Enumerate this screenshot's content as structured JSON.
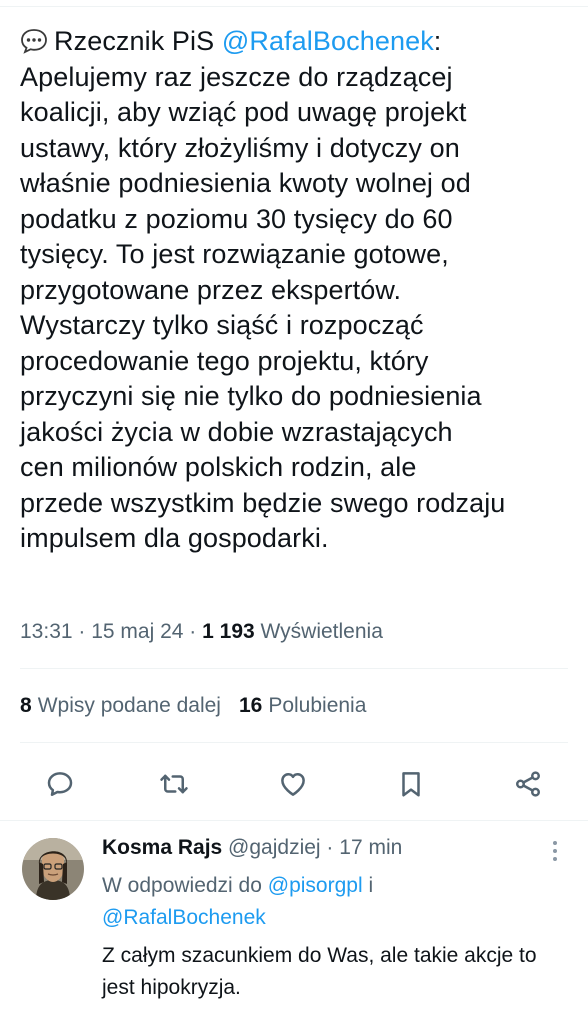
{
  "tweet": {
    "emoji_icon": "speech-bubble-icon",
    "prefix": "Rzecznik PiS ",
    "mention": "@RafalBochenek",
    "after_mention": ":",
    "lines": [
      "Apelujemy raz jeszcze do rządzącej",
      "koalicji, aby wziąć pod uwagę projekt",
      "ustawy, który złożyliśmy i dotyczy on",
      "właśnie podniesienia kwoty wolnej od",
      "podatku z poziomu 30 tysięcy do 60",
      "tysięcy. To jest rozwiązanie gotowe,",
      "przygotowane przez ekspertów.",
      "Wystarczy tylko siąść i rozpocząć",
      "procedowanie tego projektu, który",
      "przyczyni się nie tylko do podniesienia",
      "jakości życia w dobie wzrastających",
      "cen milionów polskich rodzin, ale",
      "przede wszystkim będzie swego rodzaju",
      "impulsem dla gospodarki."
    ]
  },
  "meta": {
    "time": "13:31",
    "sep1": " · ",
    "date": "15 maj 24",
    "sep2": " · ",
    "views_count": "1 193",
    "views_label": " Wyświetlenia"
  },
  "stats": {
    "retweets_count": "8",
    "retweets_label": "Wpisy podane dalej",
    "likes_count": "16",
    "likes_label": "Polubienia"
  },
  "actions": [
    {
      "name": "reply-icon"
    },
    {
      "name": "retweet-icon"
    },
    {
      "name": "like-icon"
    },
    {
      "name": "bookmark-icon"
    },
    {
      "name": "share-icon"
    }
  ],
  "reply": {
    "author_name": "Kosma Rajs",
    "author_handle": " @gajdziej",
    "dot": " · ",
    "time": "17 min",
    "reply_to_prefix": "W odpowiedzi do ",
    "reply_to_1": "@pisorgpl",
    "reply_to_joiner": " i",
    "reply_to_2": "@RafalBochenek",
    "text": "Z całym szacunkiem do Was, ale takie akcje to jest hipokryzja."
  },
  "colors": {
    "accent": "#1d9bf0",
    "text": "#0f1419",
    "muted": "#536471",
    "divider": "#eff3f4"
  }
}
